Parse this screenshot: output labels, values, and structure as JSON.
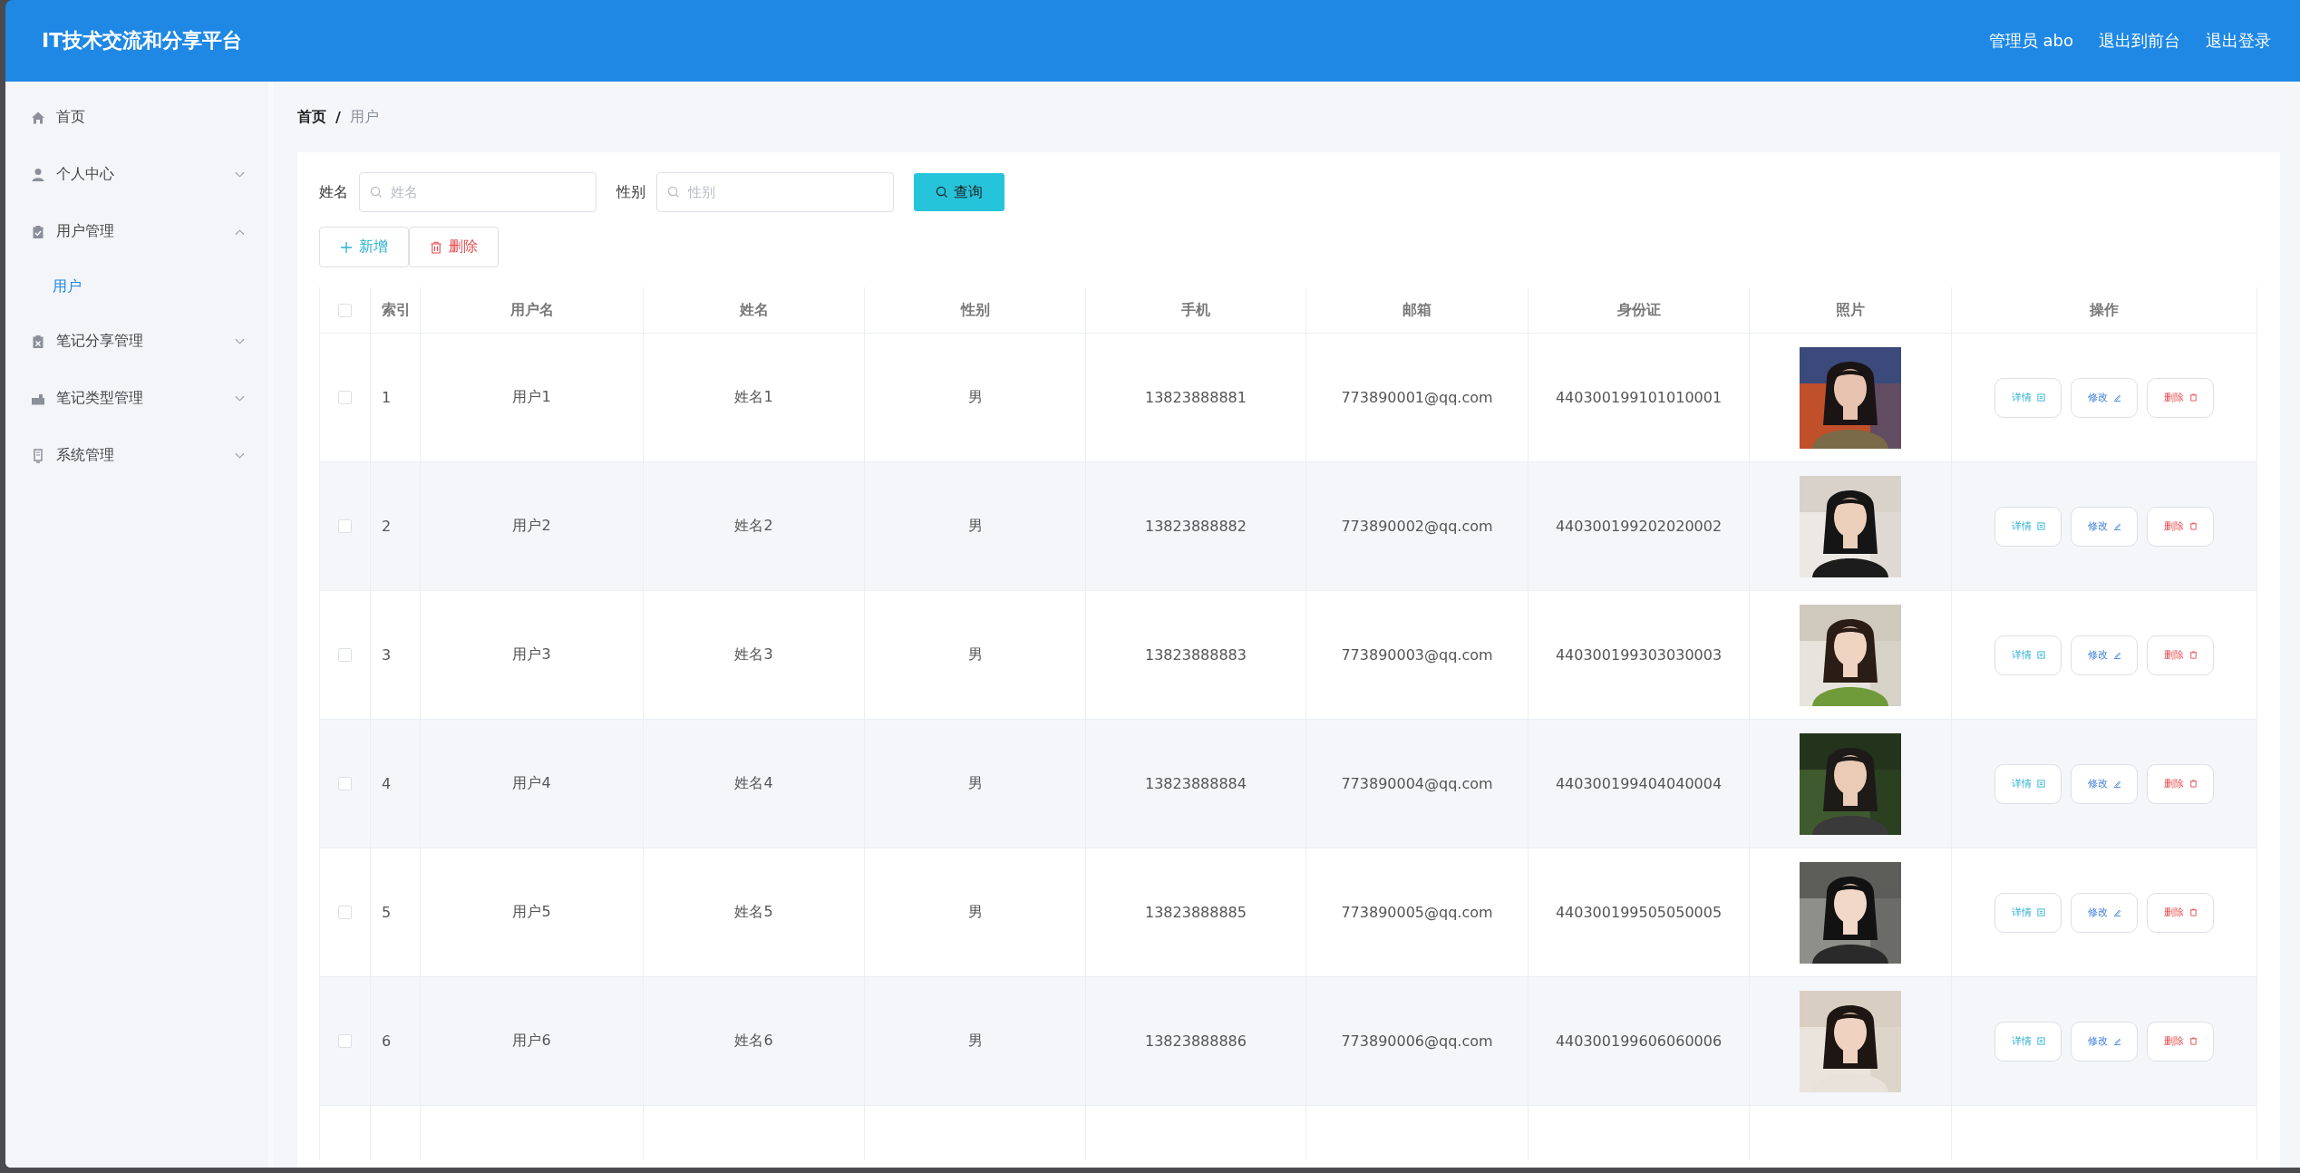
{
  "header": {
    "title": "IT技术交流和分享平台",
    "user": "管理员 abo",
    "links": [
      "退出到前台",
      "退出登录"
    ]
  },
  "sidebar": {
    "items": [
      {
        "label": "首页"
      },
      {
        "label": "个人中心",
        "expanded": false
      },
      {
        "label": "用户管理",
        "expanded": true,
        "children": [
          {
            "label": "用户",
            "selected": true
          }
        ]
      },
      {
        "label": "笔记分享管理",
        "expanded": false
      },
      {
        "label": "笔记类型管理",
        "expanded": false
      },
      {
        "label": "系统管理",
        "expanded": false
      }
    ]
  },
  "breadcrumb": [
    "首页",
    "/",
    "用户"
  ],
  "search": {
    "fields": [
      {
        "label": "姓名",
        "placeholder": "姓名"
      },
      {
        "label": "性别",
        "placeholder": "性别"
      }
    ],
    "button": "查询"
  },
  "toolbar": [
    {
      "label": "新增",
      "kind": "add"
    },
    {
      "label": "删除",
      "kind": "delete"
    }
  ],
  "table": {
    "columns": [
      "索引",
      "用户名",
      "姓名",
      "性别",
      "手机",
      "邮箱",
      "身份证",
      "照片",
      "操作"
    ],
    "header_checked": false,
    "rows": [
      {
        "checked": false,
        "cells": [
          "1",
          "用户1",
          "姓名1",
          "男",
          "13823888881",
          "773890001@qq.com",
          "440300199101010001"
        ],
        "actions": [
          {
            "label": "详情",
            "kind": "detail"
          },
          {
            "label": "修改",
            "kind": "edit"
          },
          {
            "label": "删除",
            "kind": "delete"
          }
        ]
      },
      {
        "checked": false,
        "cells": [
          "2",
          "用户2",
          "姓名2",
          "男",
          "13823888882",
          "773890002@qq.com",
          "440300199202020002"
        ],
        "actions": [
          {
            "label": "详情",
            "kind": "detail"
          },
          {
            "label": "修改",
            "kind": "edit"
          },
          {
            "label": "删除",
            "kind": "delete"
          }
        ]
      },
      {
        "checked": false,
        "cells": [
          "3",
          "用户3",
          "姓名3",
          "男",
          "13823888883",
          "773890003@qq.com",
          "440300199303030003"
        ],
        "actions": [
          {
            "label": "详情",
            "kind": "detail"
          },
          {
            "label": "修改",
            "kind": "edit"
          },
          {
            "label": "删除",
            "kind": "delete"
          }
        ]
      },
      {
        "checked": false,
        "cells": [
          "4",
          "用户4",
          "姓名4",
          "男",
          "13823888884",
          "773890004@qq.com",
          "440300199404040004"
        ],
        "actions": [
          {
            "label": "详情",
            "kind": "detail"
          },
          {
            "label": "修改",
            "kind": "edit"
          },
          {
            "label": "删除",
            "kind": "delete"
          }
        ]
      },
      {
        "checked": false,
        "cells": [
          "5",
          "用户5",
          "姓名5",
          "男",
          "13823888885",
          "773890005@qq.com",
          "440300199505050005"
        ],
        "actions": [
          {
            "label": "详情",
            "kind": "detail"
          },
          {
            "label": "修改",
            "kind": "edit"
          },
          {
            "label": "删除",
            "kind": "delete"
          }
        ]
      },
      {
        "checked": false,
        "cells": [
          "6",
          "用户6",
          "姓名6",
          "男",
          "13823888886",
          "773890006@qq.com",
          "440300199606060006"
        ],
        "actions": [
          {
            "label": "详情",
            "kind": "detail"
          },
          {
            "label": "修改",
            "kind": "edit"
          },
          {
            "label": "删除",
            "kind": "delete"
          }
        ]
      }
    ]
  }
}
